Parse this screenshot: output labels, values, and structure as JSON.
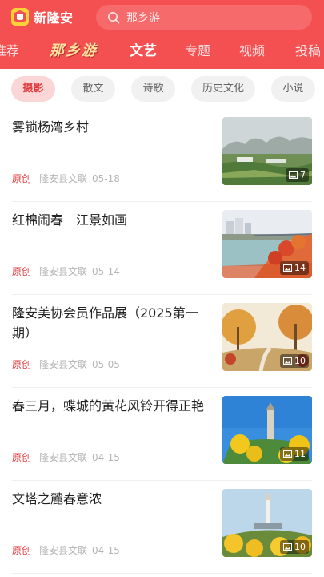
{
  "app": {
    "name": "新隆安"
  },
  "search": {
    "placeholder": "那乡游"
  },
  "channels": [
    {
      "label": "推荐"
    },
    {
      "label": "那乡游"
    },
    {
      "label": "文艺"
    },
    {
      "label": "专题"
    },
    {
      "label": "视频"
    },
    {
      "label": "投稿"
    }
  ],
  "active_channel": "文艺",
  "subtabs": [
    {
      "label": "摄影"
    },
    {
      "label": "散文"
    },
    {
      "label": "诗歌"
    },
    {
      "label": "历史文化"
    },
    {
      "label": "小说"
    }
  ],
  "active_subtab": "摄影",
  "articles": [
    {
      "title": "雾锁杨湾乡村",
      "tag": "原创",
      "source": "隆安县文联",
      "date": "05-18",
      "photo_count": "7"
    },
    {
      "title": "红棉闹春　江景如画",
      "tag": "原创",
      "source": "隆安县文联",
      "date": "05-14",
      "photo_count": "14"
    },
    {
      "title": "隆安美协会员作品展（2025第一期）",
      "tag": "原创",
      "source": "隆安县文联",
      "date": "05-05",
      "photo_count": "10"
    },
    {
      "title": "春三月，蝶城的黄花风铃开得正艳",
      "tag": "原创",
      "source": "隆安县文联",
      "date": "04-15",
      "photo_count": "11"
    },
    {
      "title": "文塔之麓春意浓",
      "tag": "原创",
      "source": "隆安县文联",
      "date": "04-15",
      "photo_count": "10"
    }
  ],
  "colors": {
    "brand": "#f45052",
    "accent": "#e0393b"
  }
}
